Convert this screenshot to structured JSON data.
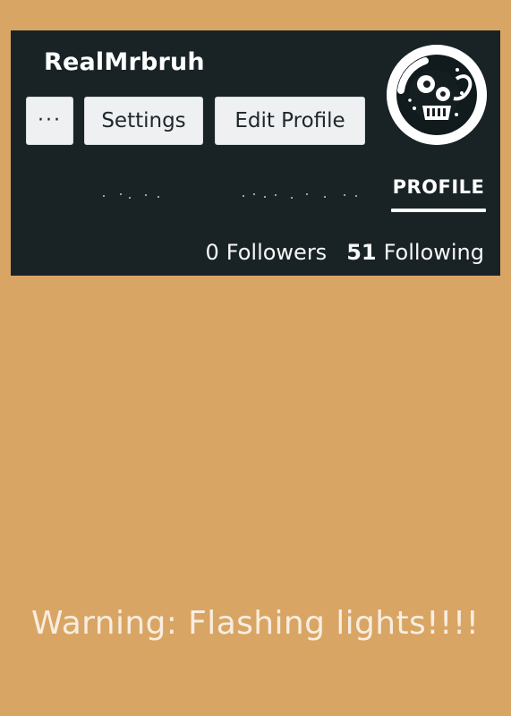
{
  "profile": {
    "username": "RealMrbruh",
    "buttons": {
      "more": "···",
      "settings": "Settings",
      "edit_profile": "Edit Profile"
    },
    "avatar_icon": "skull-avatar-icon",
    "tabs": {
      "active": "PROFILE"
    },
    "stats": {
      "followers_count": "0",
      "followers_label": "Followers",
      "following_count": "51",
      "following_label": "Following"
    }
  },
  "warning": "Warning: Flashing lights!!!!",
  "colors": {
    "background": "#d9a564",
    "card": "#192326",
    "button": "#eef0f2",
    "text_light": "#ffffff"
  }
}
